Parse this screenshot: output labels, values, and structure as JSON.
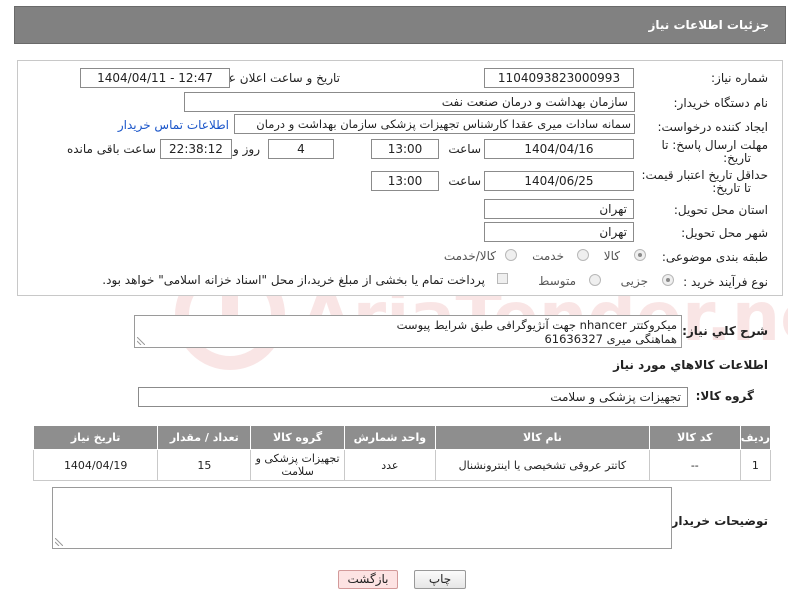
{
  "header": {
    "title": "جزئیات اطلاعات نیاز"
  },
  "form": {
    "need_number_label": "شماره نیاز:",
    "need_number_value": "1104093823000993",
    "announce_label": "تاریخ و ساعت اعلان عمومی:",
    "announce_value": "1404/04/11 - 12:47",
    "buyer_org_label": "نام دستگاه خریدار:",
    "buyer_org_value": "سازمان بهداشت و درمان صنعت نفت",
    "requester_label": "ایجاد کننده درخواست:",
    "requester_value": "سمانه سادات میری عقدا کارشناس تجهیزات پزشکی سازمان بهداشت و درمان",
    "contact_link": "اطلاعات تماس خریدار",
    "reply_deadline_label_1": "مهلت ارسال پاسخ: تا",
    "reply_deadline_label_2": "تاریخ:",
    "reply_date": "1404/04/16",
    "time_label": "ساعت",
    "reply_time": "13:00",
    "days_value": "4",
    "days_label": "روز و",
    "remaining_time": "22:38:12",
    "remaining_label": "ساعت باقی مانده",
    "price_validity_label_1": "حداقل تاریخ اعتبار قیمت:",
    "price_validity_label_2": "تا تاریخ:",
    "price_date": "1404/06/25",
    "price_time": "13:00",
    "province_label": "استان محل تحویل:",
    "province_value": "تهران",
    "city_label": "شهر محل تحویل:",
    "city_value": "تهران",
    "category_label": "طبقه بندی موضوعی:",
    "category_options": [
      "کالا",
      "خدمت",
      "کالا/خدمت"
    ],
    "purchase_type_label": "نوع فرآیند خرید :",
    "purchase_options": [
      "جزیی",
      "متوسط"
    ],
    "payment_note": "پرداخت تمام یا بخشی از مبلغ خرید،از محل \"اسناد خزانه اسلامی\" خواهد بود."
  },
  "description": {
    "label": "شرح كلي نياز:",
    "line1": "میکروکتتر nhancer جهت آنژیوگرافی طبق شرایط پیوست",
    "line2": "هماهنگی میری 61636327"
  },
  "goods_section": {
    "title": "اطلاعات كالاهاي مورد نياز",
    "group_label": "گروه کالا:",
    "group_value": "تجهیزات پزشکی و سلامت"
  },
  "table": {
    "headers": [
      "ردیف",
      "کد کالا",
      "نام کالا",
      "واحد شمارش",
      "گروه کالا",
      "تعداد / مقدار",
      "تاریخ نیاز"
    ],
    "rows": [
      [
        "1",
        "--",
        "کاتتر عروقی تشخیصی یا اینترونشنال",
        "عدد",
        "تجهیزات پزشکی و سلامت",
        "15",
        "1404/04/19"
      ]
    ]
  },
  "buyer_notes": {
    "label": "توضیحات خریدار:"
  },
  "buttons": {
    "print": "چاپ",
    "back": "بازگشت"
  },
  "watermark": {
    "text": "AriaTender.neT"
  },
  "colors": {
    "header_bg": "#818181",
    "table_header_bg": "#8e8e8e",
    "link": "#1a55c9",
    "back_button_bg": "#fde3e3"
  }
}
